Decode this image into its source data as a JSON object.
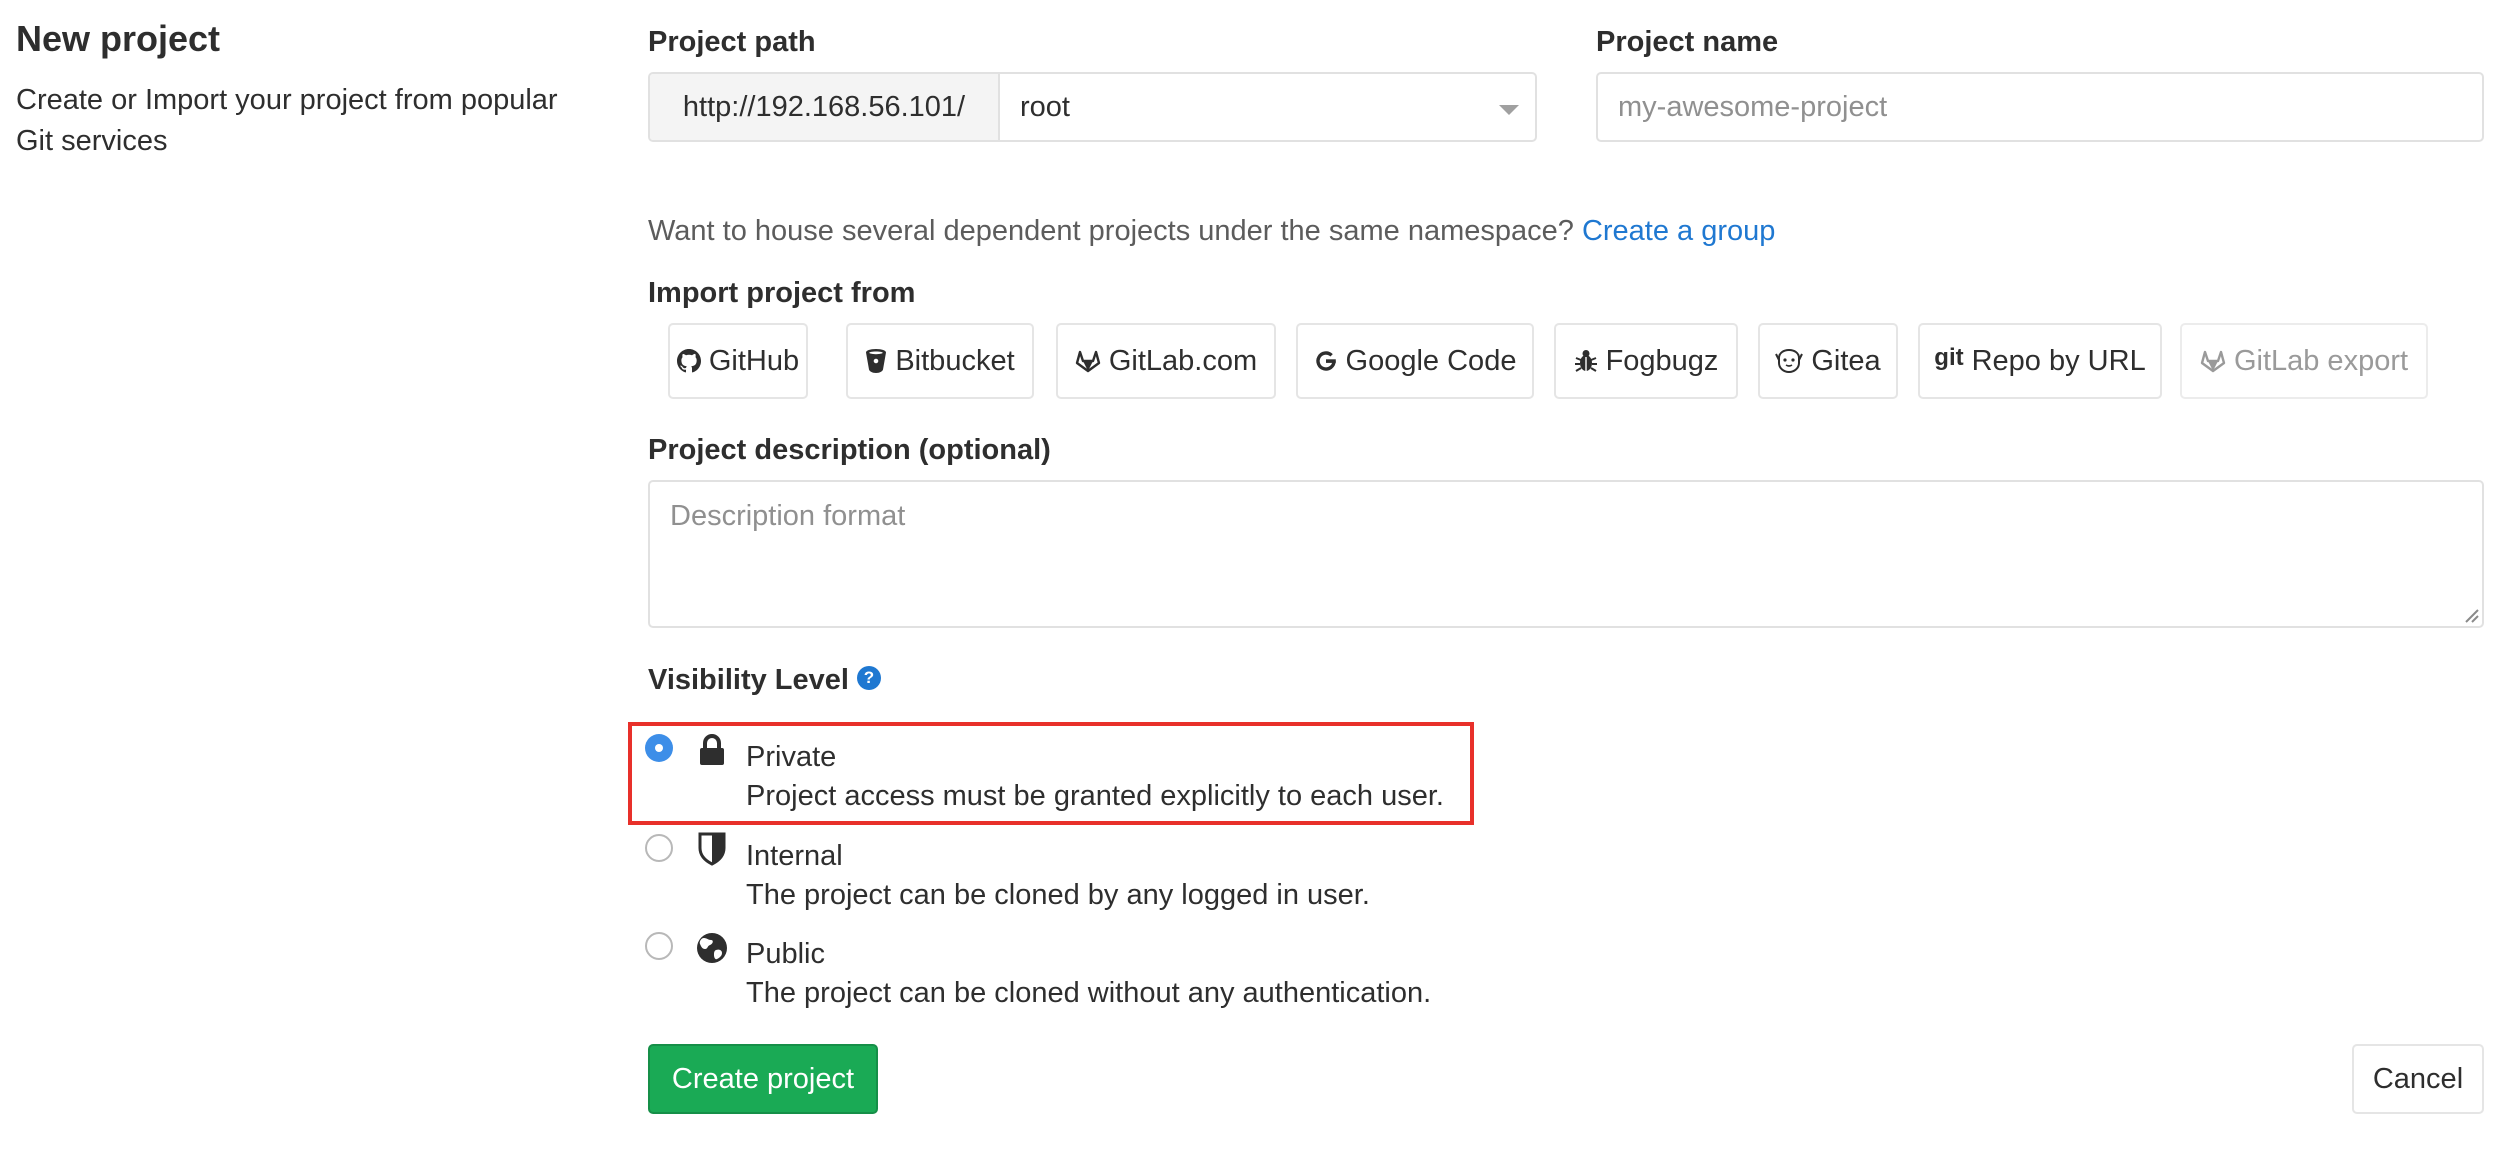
{
  "page": {
    "title": "New project",
    "subtitle": "Create or Import your project from popular Git services"
  },
  "project_path": {
    "label": "Project path",
    "prefix": "http://192.168.56.101/",
    "namespace": "root"
  },
  "project_name": {
    "label": "Project name",
    "placeholder": "my-awesome-project"
  },
  "group_hint": {
    "text": "Want to house several dependent projects under the same namespace? ",
    "link": "Create a group"
  },
  "import": {
    "label": "Import project from",
    "sources": [
      {
        "label": "GitHub",
        "icon": "github-icon"
      },
      {
        "label": "Bitbucket",
        "icon": "bitbucket-icon"
      },
      {
        "label": "GitLab.com",
        "icon": "gitlab-icon"
      },
      {
        "label": "Google Code",
        "icon": "google-icon"
      },
      {
        "label": "Fogbugz",
        "icon": "bug-icon"
      },
      {
        "label": "Gitea",
        "icon": "gitea-icon"
      },
      {
        "label": "Repo by URL",
        "icon": "git-icon",
        "icon_text": "git"
      },
      {
        "label": "GitLab export",
        "icon": "gitlab-icon",
        "disabled": true
      }
    ]
  },
  "description": {
    "label": "Project description (optional)",
    "placeholder": "Description format"
  },
  "visibility": {
    "label": "Visibility Level",
    "help_icon": "?",
    "options": [
      {
        "title": "Private",
        "description": "Project access must be granted explicitly to each user.",
        "icon": "lock-icon",
        "selected": true
      },
      {
        "title": "Internal",
        "description": "The project can be cloned by any logged in user.",
        "icon": "shield-icon",
        "selected": false
      },
      {
        "title": "Public",
        "description": "The project can be cloned without any authentication.",
        "icon": "globe-icon",
        "selected": false
      }
    ]
  },
  "actions": {
    "create": "Create project",
    "cancel": "Cancel"
  },
  "colors": {
    "primary_green": "#1aaa55",
    "link_blue": "#1f78d1",
    "highlight_red": "#e8302a",
    "radio_selected": "#3d8ee8"
  }
}
